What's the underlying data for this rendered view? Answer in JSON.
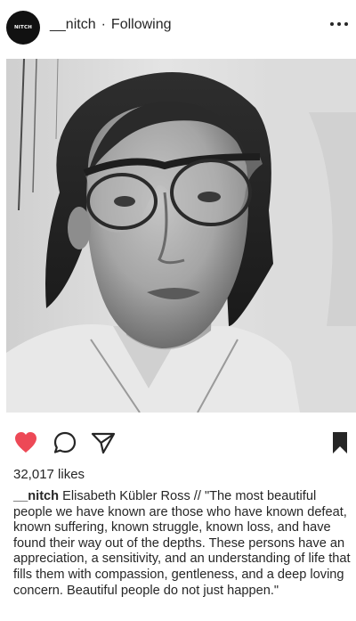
{
  "post": {
    "avatar_text": "NITCH",
    "username": "__nitch",
    "separator": "·",
    "follow_status": "Following",
    "likes": "32,017 likes",
    "caption_user": "__nitch",
    "caption_text": "Elisabeth Kübler Ross // \"The most beautiful people we have known are those who have known defeat, known suffering, known struggle, known loss, and have found their way out of the depths. These persons have an appreciation, a sensitivity, and an understanding of life that fills them with compassion, gentleness, and a deep loving concern. Beautiful people do not just happen.\""
  },
  "icons": {
    "more": "more-options-icon",
    "like": "heart-icon",
    "comment": "comment-icon",
    "share": "share-icon",
    "save": "bookmark-icon"
  },
  "colors": {
    "like_active": "#ed4956",
    "text": "#262626"
  }
}
